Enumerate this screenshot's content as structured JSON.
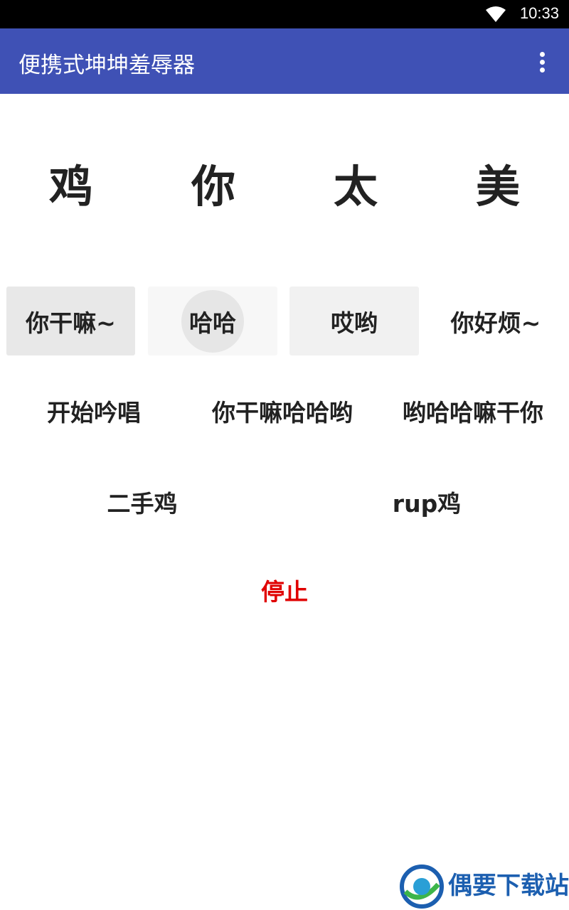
{
  "status_bar": {
    "time": "10:33",
    "icon": "wifi-icon"
  },
  "app_bar": {
    "title": "便携式坤坤羞辱器",
    "menu_icon": "more-vert-icon",
    "color": "#3f51b5"
  },
  "big_text": [
    "鸡",
    "你",
    "太",
    "美"
  ],
  "buttons_row1": [
    "你干嘛~",
    "哈哈",
    "哎哟",
    "你好烦~"
  ],
  "buttons_row2": [
    "开始吟唱",
    "你干嘛哈哈哟",
    "哟哈哈嘛干你"
  ],
  "buttons_row3": [
    "二手鸡",
    "rup鸡"
  ],
  "stop_label": "停止",
  "stop_color": "#e00000",
  "watermark": {
    "title": "偶要下载站"
  }
}
